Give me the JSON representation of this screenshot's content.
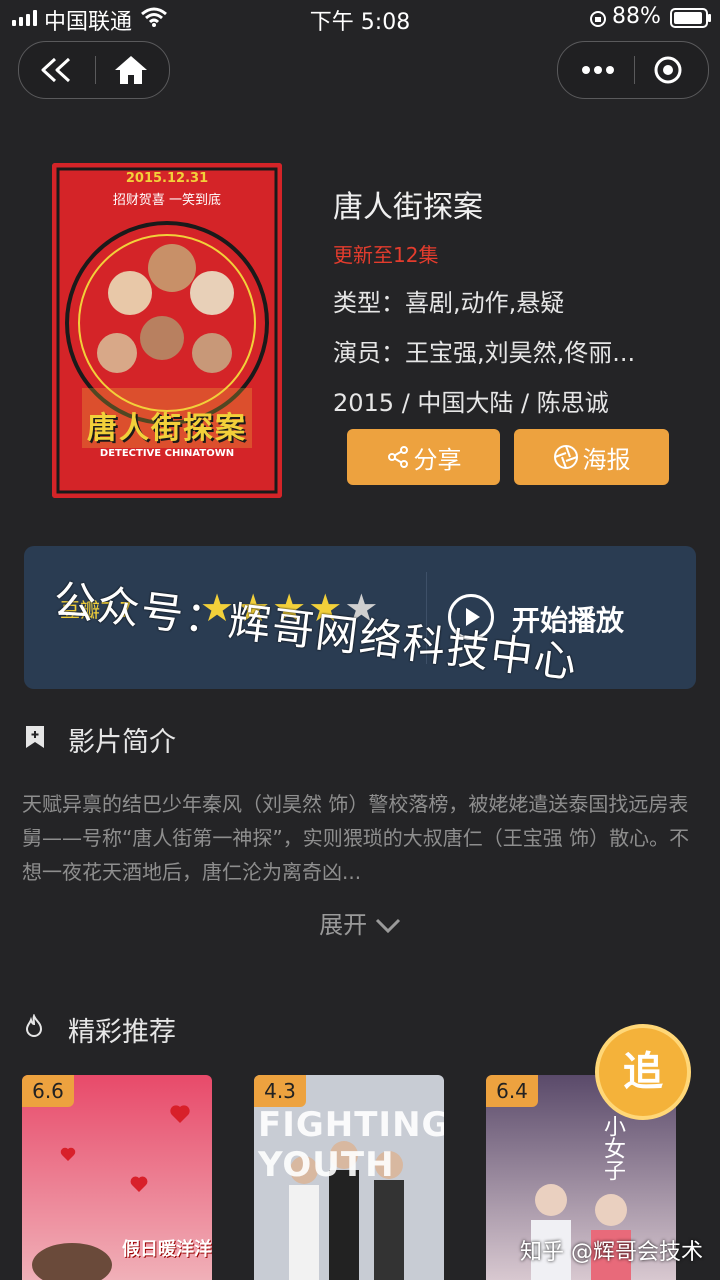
{
  "status_bar": {
    "carrier": "中国联通",
    "time": "下午 5:08",
    "battery": "88%"
  },
  "nav": {
    "back_icon": "double-chevron-left-icon",
    "home_icon": "home-icon",
    "more_icon": "more-dots-icon",
    "close_icon": "target-close-icon"
  },
  "movie": {
    "title": "唐人街探案",
    "update": "更新至12集",
    "genre": "类型：喜剧,动作,悬疑",
    "cast": "演员：王宝强,刘昊然,佟丽...",
    "info": "2015 / 中国大陆 / 陈思诚",
    "poster": {
      "date_text": "2015.12.31",
      "tagline": "招财贺喜 一笑到底",
      "cn_title": "唐人街探案",
      "en_title": "DETECTIVE CHINATOWN"
    }
  },
  "actions": {
    "share": "分享",
    "poster": "海报"
  },
  "play": {
    "rating_label": "豆瓣7.7",
    "stars_filled": 4,
    "stars_total": 5,
    "label": "开始播放"
  },
  "watermark": "公众号：辉哥网络科技中心",
  "intro": {
    "title": "影片简介",
    "text": "天赋异禀的结巴少年秦风（刘昊然 饰）警校落榜，被姥姥遣送泰国找远房表舅——号称“唐人街第一神探”，实则猥琐的大叔唐仁（王宝强 饰）散心。不想一夜花天酒地后，唐仁沦为离奇凶...",
    "expand": "展开"
  },
  "recommend": {
    "title": "精彩推荐",
    "items": [
      {
        "score": "6.6",
        "poster_text": "假日暖洋洋"
      },
      {
        "score": "4.3",
        "poster_text": "FIGHTING YOUTH"
      },
      {
        "score": "6.4",
        "poster_text": "小女子"
      }
    ]
  },
  "follow_button": "追",
  "zhihu_watermark": "知乎 @辉哥会技术",
  "colors": {
    "background": "#242426",
    "accent": "#eda23f",
    "update_red": "#e43c2d",
    "play_bar": "#2a3c52",
    "star": "#f2d03a"
  }
}
